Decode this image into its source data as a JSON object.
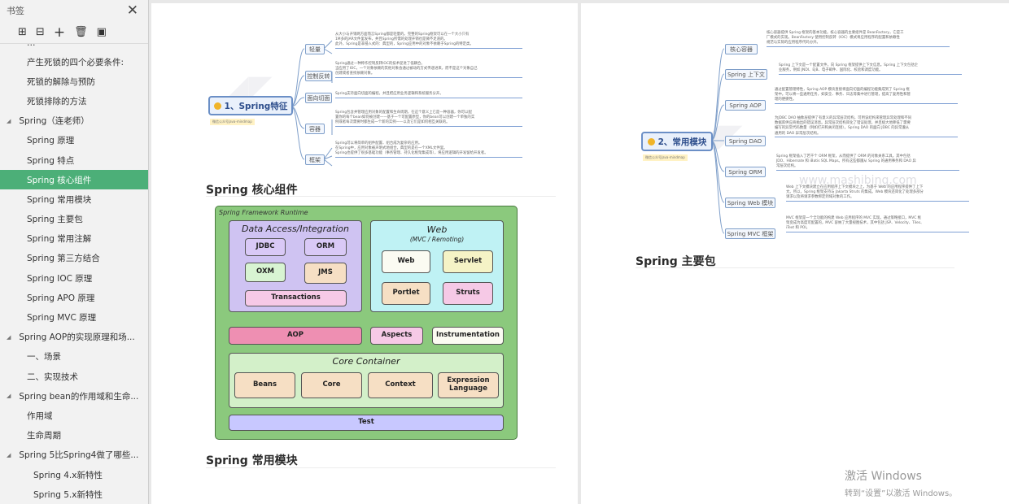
{
  "sidebar": {
    "title": "书签",
    "items": [
      {
        "label": "产生死锁的四个必要条件:",
        "level": 2
      },
      {
        "label": "死锁的解除与预防",
        "level": 2
      },
      {
        "label": "死锁排除的方法",
        "level": 2
      },
      {
        "label": "Spring（连老师）",
        "level": 1
      },
      {
        "label": "Spring 原理",
        "level": 2
      },
      {
        "label": "Spring 特点",
        "level": 2
      },
      {
        "label": "Spring 核心组件",
        "level": 2,
        "active": true
      },
      {
        "label": "Spring 常用模块",
        "level": 2
      },
      {
        "label": "Spring 主要包",
        "level": 2
      },
      {
        "label": "Spring 常用注解",
        "level": 2
      },
      {
        "label": "Spring 第三方结合",
        "level": 2
      },
      {
        "label": "Spring IOC 原理",
        "level": 2
      },
      {
        "label": "Spring APO 原理",
        "level": 2
      },
      {
        "label": "Spring MVC 原理",
        "level": 2
      },
      {
        "label": "Spring AOP的实现原理和场...",
        "level": 1
      },
      {
        "label": "一、场景",
        "level": 2
      },
      {
        "label": "二、实现技术",
        "level": 2
      },
      {
        "label": "Spring bean的作用域和生命...",
        "level": 1
      },
      {
        "label": "作用域",
        "level": 2
      },
      {
        "label": "生命周期",
        "level": 2
      },
      {
        "label": "Spring 5比Spring4做了哪些...",
        "level": 1
      },
      {
        "label": "Spring 4.x新特性",
        "level": 3
      },
      {
        "label": "Spring 5.x新特性",
        "level": 3
      }
    ]
  },
  "left_page": {
    "mindmap1": {
      "root": "1、Spring特征",
      "sub": "微信公众号java-mindmap",
      "nodes": [
        {
          "label": "轻量",
          "desc": [
            "从大小与开销两方面而言Spring都是轻量的。完整的Spring框架可以在一个大小只有",
            "1M多的JAR文件里发布，并且Spring所需的处理开销也是微不足道的。",
            "此外，Spring是非侵入式的：典型的，Spring应用中的对象不依赖于Spring的特定类。"
          ]
        },
        {
          "label": "控制反转",
          "desc": [
            "Spring通过一种称作控制反转IOC的技术促进了低耦合。",
            "当应用了IOC，一个对象依赖的其他对象会通过被动的方式传递进来，而不是这个对象自己",
            "创建或者查找依赖对象。"
          ]
        },
        {
          "label": "面向切面",
          "desc": [
            "Spring支持面向切面的编程，并且把应用业务逻辑和系统服务分开。"
          ]
        },
        {
          "label": "容器",
          "desc": [
            "Spring包含并管理应用对象的配置和生命周期，在这个意义上它是一种容器，你可以配",
            "置你的每个bean如何被创建——基于一个可配置原型，你的bean可以创建一个单独的实",
            "例或者每次需要时都生成一个新的实例——以及它们是如何相互关联的。"
          ]
        },
        {
          "label": "框架",
          "desc": [
            "Spring可以将简单的组件配置、组合成为复杂的应用。",
            "在Spring中，应用对象被声明式地组合，典型的是在一个XML文件里。",
            "Spring也提供了很多基础功能（事务管理、持久化框架集成等），将应用逻辑的开发留给开发者。"
          ]
        }
      ]
    },
    "heading1": "Spring 核心组件",
    "diagram": {
      "title": "Spring Framework Runtime",
      "data_access": {
        "title": "Data Access/Integration",
        "items": [
          "JDBC",
          "ORM",
          "OXM",
          "JMS",
          "Transactions"
        ]
      },
      "web": {
        "title": "Web",
        "subtitle": "(MVC / Remoting)",
        "items": [
          "Web",
          "Servlet",
          "Portlet",
          "Struts"
        ]
      },
      "middle": [
        "AOP",
        "Aspects",
        "Instrumentation"
      ],
      "core": {
        "title": "Core Container",
        "items": [
          "Beans",
          "Core",
          "Context",
          "Expression Language"
        ]
      },
      "test": "Test"
    },
    "heading2": "Spring 常用模块"
  },
  "right_page": {
    "mindmap2": {
      "root": "2、常用模块",
      "sub": "微信公众号java-mindmap",
      "nodes": [
        {
          "label": "核心容器",
          "desc": [
            "核心容器提供 Spring 框架的基本功能。核心容器的主要组件是 BeanFactory，它是工",
            "厂模式的实现。BeanFactory 使用控制反转（IOC）模式将应用程序的配置和依赖性",
            "规范与实际的应用程序代码分开。"
          ]
        },
        {
          "label": "Spring 上下文",
          "desc": [
            "Spring 上下文是一个配置文件，向 Spring 框架提供上下文信息。Spring 上下文包括企",
            "业服务，例如 JNDI、EJB、电子邮件、国际化、校验和调度功能。"
          ]
        },
        {
          "label": "Spring AOP",
          "desc": [
            "通过配置管理特性，Spring AOP 模块直接将面向切面的编程功能集成到了 Spring 框",
            "架中。可以将一些通用任务，如安全、事务、日志等集中进行管理，提高了复用性和管",
            "理的便捷性。"
          ]
        },
        {
          "label": "Spring DAO",
          "desc": [
            "为JDBC DAO 抽象层提供了有意义的异常层次结构，可用该结构来管理异常处理和不同",
            "数据库供应商抛出的错误消息。异常层次结构简化了错误处理，并且极大地降低了需要",
            "编写的异常代码数量（例如打开和关闭连接）。Spring DAO 的面向 JDBC 的异常遵从",
            "通用的 DAO 异常层次结构。"
          ]
        },
        {
          "label": "Spring ORM",
          "desc": [
            "Spring 框架插入了若干个 ORM 框架，从而提供了 ORM 的对象关系工具，其中包括",
            "JDO、Hibernate 和 iBatis SQL Maps。所有这些都遵从 Spring 的通用事务和 DAO 异",
            "常层次结构。"
          ]
        },
        {
          "label": "Spring Web 模块",
          "desc": [
            "Web 上下文模块建立在应用程序上下文模块之上，为基于 Web 的应用程序提供了上下",
            "文。所以，Spring 框架支持与 Jakarta Struts 的集成。Web 模块还简化了处理多部分",
            "请求以及将请求参数绑定到域对象的工作。"
          ]
        },
        {
          "label": "Spring MVC 框架",
          "desc": [
            "MVC 框架是一个全功能的构建 Web 应用程序的 MVC 实现。通过策略接口，MVC 框",
            "架变成为高度可配置的，MVC 容纳了大量视图技术，其中包括 JSP、Velocity、Tiles、",
            "iText 和 POI。"
          ]
        }
      ]
    },
    "watermark_text": "www.mashibing.com",
    "heading": "Spring 主要包"
  },
  "activation": {
    "line1": "激活 Windows",
    "line2": "转到“设置”以激活 Windows。"
  }
}
